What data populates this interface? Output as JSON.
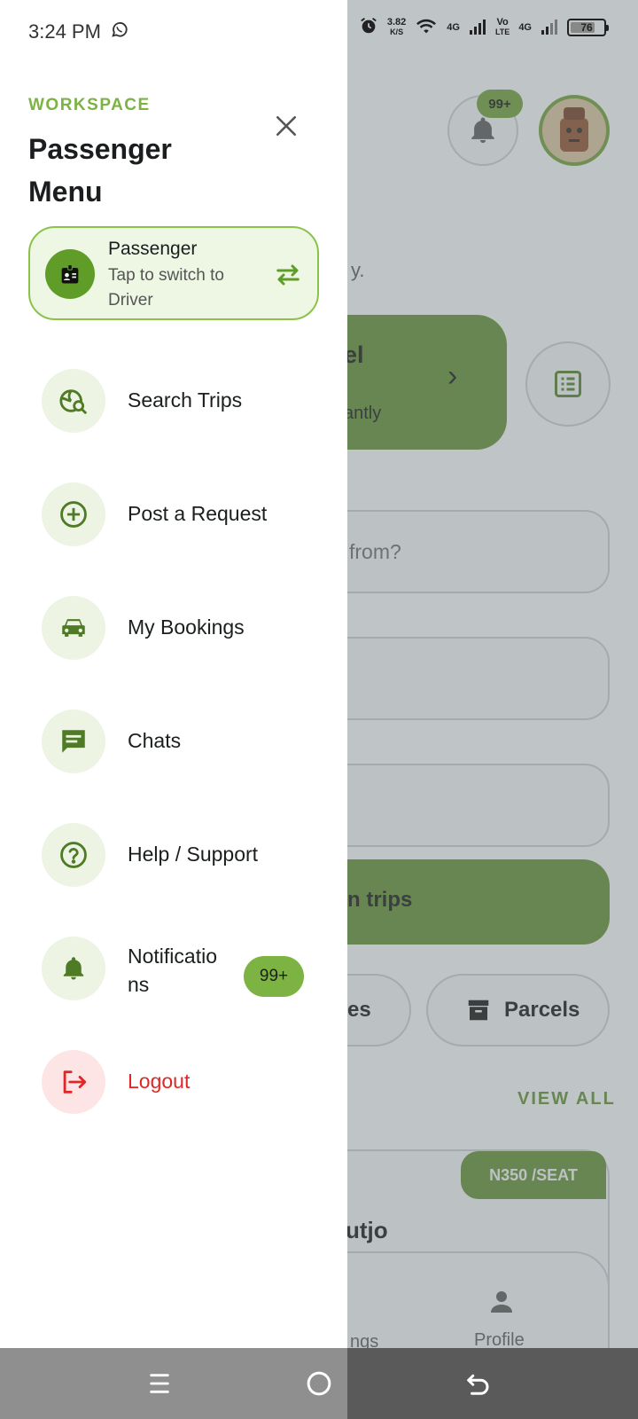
{
  "status_bar": {
    "time": "3:24 PM",
    "net_speed": "3.82",
    "net_unit": "K/S",
    "net_4g_1": "4G",
    "volte_top": "Vo",
    "volte_bottom": "LTE",
    "net_4g_2": "4G",
    "battery": "76",
    "battery_level": 0.76
  },
  "drawer": {
    "section_label": "WORKSPACE",
    "title": "Passenger Menu",
    "role_card": {
      "name": "Passenger",
      "hint": "Tap to switch to Driver"
    },
    "items": [
      {
        "label": "Search Trips",
        "icon": "search-trips-icon"
      },
      {
        "label": "Post a Request",
        "icon": "add-circle-icon"
      },
      {
        "label": "My Bookings",
        "icon": "car-icon"
      },
      {
        "label": "Chats",
        "icon": "chat-icon"
      },
      {
        "label": "Help / Support",
        "icon": "help-icon"
      },
      {
        "label": "Notifications",
        "icon": "bell-icon",
        "badge": "99+"
      },
      {
        "label": "Logout",
        "icon": "logout-icon"
      }
    ]
  },
  "background": {
    "bell_badge": "99+",
    "subtitle_fragment": "y.",
    "card_title_fragment": "el",
    "card_sub_fragment": "antly",
    "from_placeholder_fragment": "from?",
    "search_button_fragment": "n trips",
    "chip_left_fragment": "es",
    "chip_right": "Parcels",
    "view_all": "VIEW ALL",
    "price_tag": "N350 /SEAT",
    "trip_name_fragment": "utjo",
    "nav_bookings_fragment": "ngs",
    "nav_profile": "Profile"
  },
  "colors": {
    "accent_green": "#7cb342",
    "dark_green": "#5d8a2d",
    "logout_red": "#e02626"
  }
}
